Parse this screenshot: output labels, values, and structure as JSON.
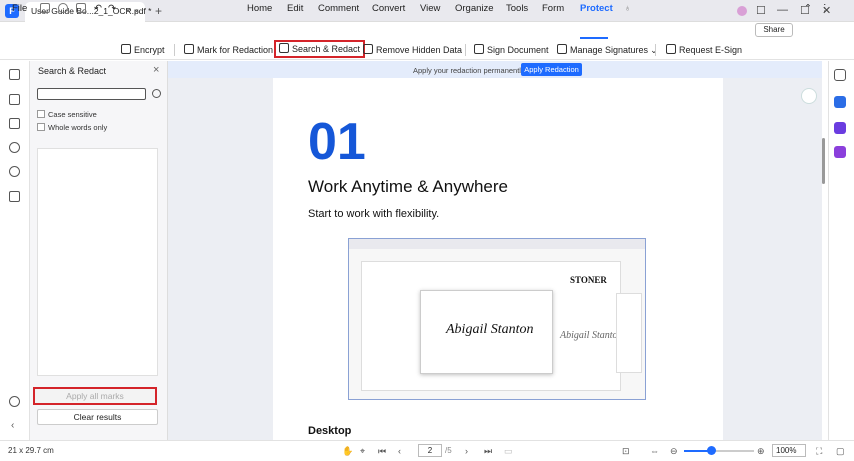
{
  "titlebar": {
    "tab_title": "User Guide Bo...2_1_OCR.pdf *",
    "tab_close": "×",
    "new_tab": "+",
    "minimize": "—",
    "maximize": "☐",
    "close": "✕"
  },
  "menubar": {
    "file": "File",
    "tabs": [
      "Home",
      "Edit",
      "Comment",
      "Convert",
      "View",
      "Organize",
      "Tools",
      "Form",
      "Protect"
    ],
    "active_tab": "Protect",
    "share": "Share"
  },
  "toolbar": {
    "encrypt": "Encrypt",
    "mark_for_redaction": "Mark for Redaction",
    "search_redact": "Search & Redact",
    "remove_hidden_data": "Remove Hidden Data",
    "sign_document": "Sign Document",
    "manage_signatures": "Manage Signatures",
    "request_esign": "Request E-Sign"
  },
  "panel": {
    "title": "Search & Redact",
    "close": "×",
    "search_placeholder": "",
    "case_sensitive": "Case sensitive",
    "whole_words": "Whole words only",
    "apply_all_marks": "Apply all marks",
    "clear_results": "Clear results"
  },
  "banner": {
    "text": "Apply your redaction permanently.",
    "button": "Apply Redaction"
  },
  "document": {
    "number": "01",
    "heading": "Work Anytime & Anywhere",
    "subheading": "Start to work with flexibility.",
    "section_title": "Desktop",
    "embedded_brand": "STONER",
    "embedded_signature": "Abigail Stanton"
  },
  "statusbar": {
    "page_size": "21 x 29.7 cm",
    "page_current": "2",
    "page_total": "/5",
    "zoom": "100%"
  },
  "colors": {
    "accent": "#1e6bff",
    "highlight_border": "#d4242a",
    "title_number": "#1557d8"
  }
}
